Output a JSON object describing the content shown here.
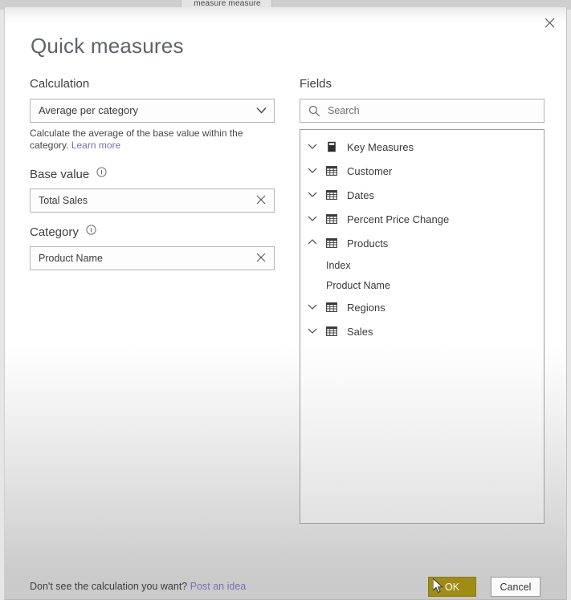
{
  "background": {
    "tab_label": "measure measure"
  },
  "dialog": {
    "title": "Quick measures",
    "close_icon": "close-icon"
  },
  "calculation": {
    "heading": "Calculation",
    "selected": "Average per category",
    "caret_icon": "chevron-down-icon",
    "description": "Calculate the average of the base value within the",
    "description_line2": "category.",
    "learn_more": "Learn more"
  },
  "base_value": {
    "heading": "Base value",
    "info_icon": "info-icon",
    "value": "Total Sales",
    "clear_icon": "close-icon"
  },
  "category": {
    "heading": "Category",
    "info_icon": "info-icon",
    "value": "Product Name",
    "clear_icon": "close-icon"
  },
  "fields": {
    "heading": "Fields",
    "search": {
      "placeholder": "Search",
      "value": "",
      "icon": "search-icon"
    },
    "tree": [
      {
        "label": "Key Measures",
        "icon": "measure-folder-icon",
        "chevron": "chevron-down-icon",
        "level": 0,
        "expanded": false
      },
      {
        "label": "Customer",
        "icon": "table-icon",
        "chevron": "chevron-down-icon",
        "level": 0,
        "expanded": false
      },
      {
        "label": "Dates",
        "icon": "table-icon",
        "chevron": "chevron-down-icon",
        "level": 0,
        "expanded": false
      },
      {
        "label": "Percent Price Change",
        "icon": "table-icon",
        "chevron": "chevron-down-icon",
        "level": 0,
        "expanded": false
      },
      {
        "label": "Products",
        "icon": "table-icon",
        "chevron": "chevron-up-icon",
        "level": 0,
        "expanded": true
      },
      {
        "label": "Index",
        "icon": "",
        "chevron": "",
        "level": 1,
        "expanded": false
      },
      {
        "label": "Product Name",
        "icon": "",
        "chevron": "",
        "level": 1,
        "expanded": false
      },
      {
        "label": "Regions",
        "icon": "table-icon",
        "chevron": "chevron-down-icon",
        "level": 0,
        "expanded": false
      },
      {
        "label": "Sales",
        "icon": "table-icon",
        "chevron": "chevron-down-icon",
        "level": 0,
        "expanded": false
      }
    ]
  },
  "footer": {
    "prompt": "Don't see the calculation you want?",
    "post_idea_link": "Post an idea",
    "ok_label": "OK",
    "cancel_label": "Cancel"
  },
  "colors": {
    "ok_button": "#a08b14",
    "link": "#7a6fb0",
    "title": "#5f6368"
  }
}
